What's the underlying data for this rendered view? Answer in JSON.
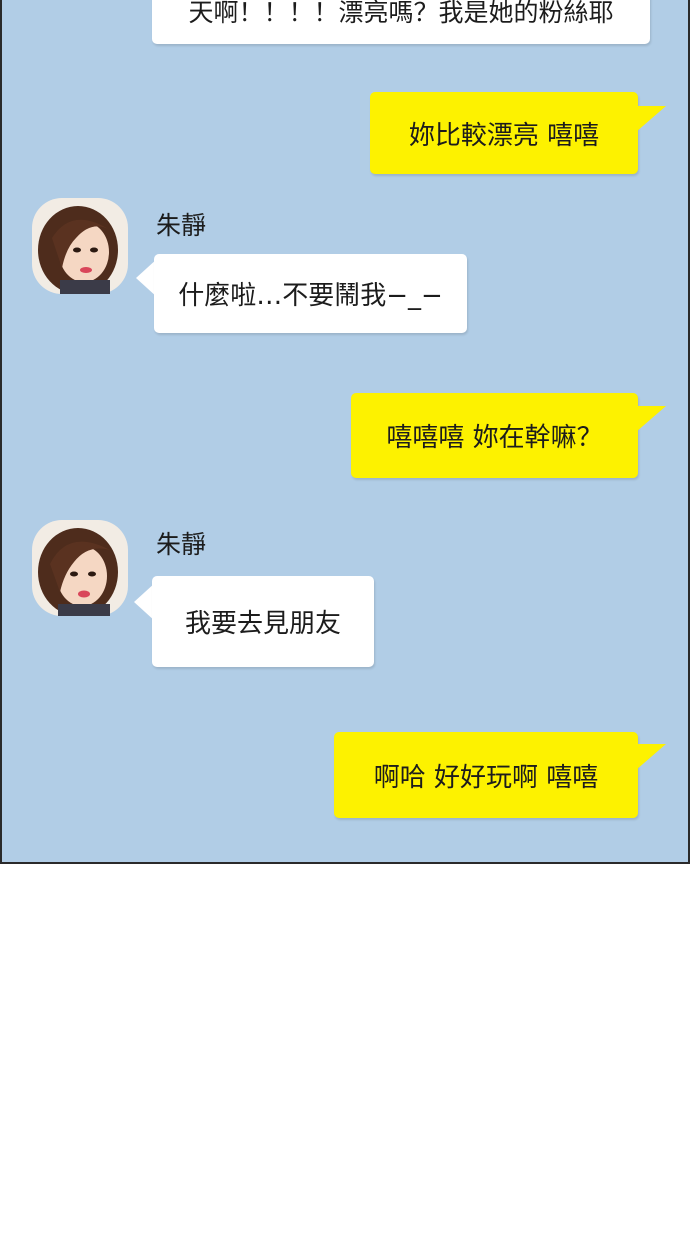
{
  "messages": {
    "m0": "天啊！！！！漂亮嗎？我是她的粉絲耶",
    "m1": "妳比較漂亮 嘻嘻",
    "m2": "什麼啦…不要鬧我−_−",
    "m3": "嘻嘻嘻 妳在幹嘛？",
    "m4": "我要去見朋友",
    "m5": "啊哈 好好玩啊 嘻嘻"
  },
  "contact": {
    "name": "朱靜"
  },
  "colors": {
    "background": "#b1cde6",
    "incoming_bubble": "#ffffff",
    "outgoing_bubble": "#fdf200",
    "page": "#ffffff"
  }
}
